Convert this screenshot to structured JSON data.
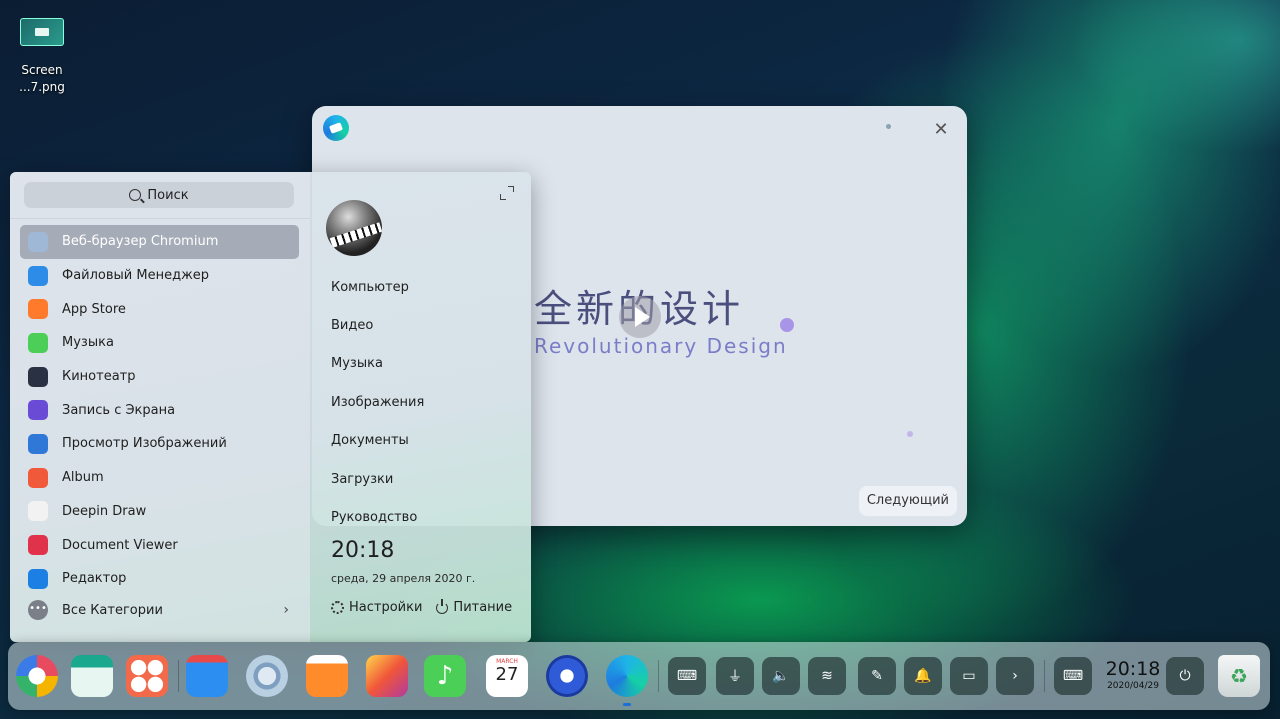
{
  "desktop": {
    "icon_label_1": "Screen",
    "icon_label_2": "...7.png"
  },
  "welcome": {
    "cn_title": "全新的设计",
    "en_title": "Revolutionary Design",
    "next_label": "Следующий",
    "close_glyph": "✕"
  },
  "launcher": {
    "search_label": "Поиск",
    "apps": [
      {
        "label": "Веб-браузер Chromium",
        "color": "#9fb8d6"
      },
      {
        "label": "Файловый Менеджер",
        "color": "#2d8ce8"
      },
      {
        "label": "App Store",
        "color": "#ff7a2a"
      },
      {
        "label": "Музыка",
        "color": "#4ccf57"
      },
      {
        "label": "Кинотеатр",
        "color": "#2a3142"
      },
      {
        "label": "Запись с Экрана",
        "color": "#6a4bd6"
      },
      {
        "label": "Просмотр Изображений",
        "color": "#2f78d8"
      },
      {
        "label": "Album",
        "color": "#f05a3a"
      },
      {
        "label": "Deepin Draw",
        "color": "#f2f2f2"
      },
      {
        "label": "Document Viewer",
        "color": "#e0324a"
      },
      {
        "label": "Редактор",
        "color": "#1c7fe3"
      }
    ],
    "all_categories": "Все Категории",
    "folders": [
      "Компьютер",
      "Видео",
      "Музыка",
      "Изображения",
      "Документы",
      "Загрузки",
      "Руководство"
    ],
    "time": "20:18",
    "date": "среда, 29 апреля 2020 г.",
    "settings": "Настройки",
    "power": "Питание"
  },
  "dock": {
    "time": "20:18",
    "date": "2020/04/29",
    "calendar_month": "MARCH",
    "calendar_day": "27"
  }
}
